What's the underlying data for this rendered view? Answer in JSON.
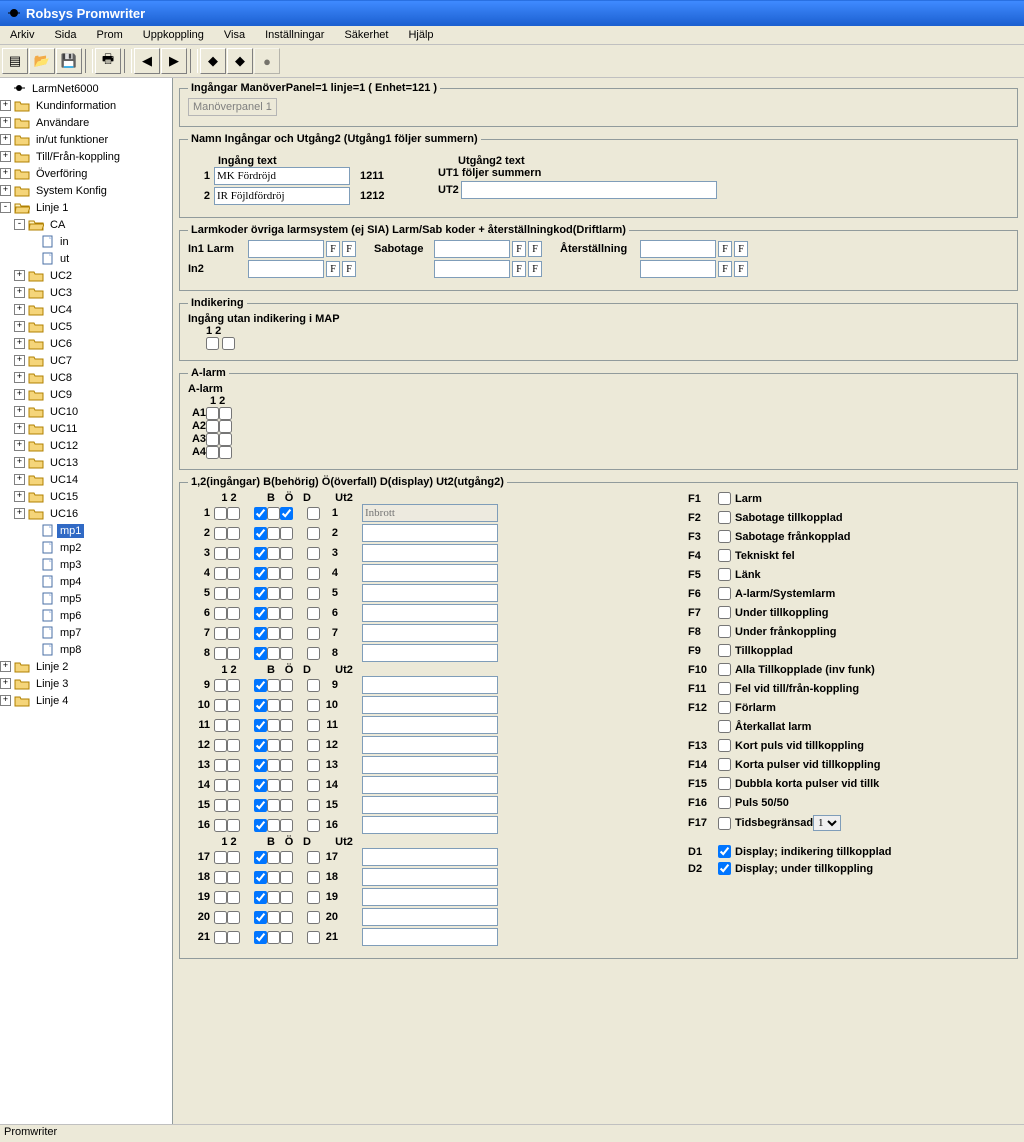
{
  "title": "Robsys Promwriter",
  "menu": [
    "Arkiv",
    "Sida",
    "Prom",
    "Uppkoppling",
    "Visa",
    "Inställningar",
    "Säkerhet",
    "Hjälp"
  ],
  "tree": {
    "root": "LarmNet6000",
    "top": [
      "Kundinformation",
      "Användare",
      "in/ut funktioner",
      "Till/Från-koppling",
      "Överföring",
      "System Konfig"
    ],
    "linje1": "Linje 1",
    "ca": "CA",
    "ca_in": "in",
    "ca_ut": "ut",
    "uc": [
      "UC2",
      "UC3",
      "UC4",
      "UC5",
      "UC6",
      "UC7",
      "UC8",
      "UC9",
      "UC10",
      "UC11",
      "UC12",
      "UC13",
      "UC14",
      "UC15",
      "UC16"
    ],
    "mp": [
      "mp1",
      "mp2",
      "mp3",
      "mp4",
      "mp5",
      "mp6",
      "mp7",
      "mp8"
    ],
    "linjer": [
      "Linje 2",
      "Linje 3",
      "Linje 4"
    ]
  },
  "fs1": {
    "legend": "Ingångar ManöverPanel=1 linje=1   ( Enhet=121 )",
    "panel": "Manöverpanel 1"
  },
  "fs2": {
    "legend": "Namn Ingångar och Utgång2 (Utgång1 följer summern)",
    "h_in": "Ingång text",
    "h_ut": "Utgång2 text",
    "r1_n": "1",
    "r1_in": "MK Fördröjd",
    "r1_code": "1211",
    "r1_utlabel": "UT1 följer summern",
    "r2_n": "2",
    "r2_in": "IR Föjldfördröj",
    "r2_code": "1212",
    "r2_utlabel": "UT2",
    "r2_ut": ""
  },
  "fs3": {
    "legend": "Larmkoder övriga larmsystem (ej SIA)   Larm/Sab koder + återställningkod(Driftlarm)",
    "in1": "In1 Larm",
    "in2": "In2",
    "sab": "Sabotage",
    "rst": "Återställning",
    "F": "F"
  },
  "fs4": {
    "legend": "Indikering",
    "txt": "Ingång utan indikering i MAP",
    "h12": "1 2"
  },
  "fs5": {
    "legend": "A-larm",
    "txt": "A-larm",
    "h12": "1 2",
    "rows": [
      "A1",
      "A2",
      "A3",
      "A4"
    ]
  },
  "fs6": {
    "legend": "1,2(ingångar)  B(behörig) Ö(överfall) D(display) Ut2(utgång2)",
    "h12": "1  2",
    "hB": "B",
    "hO": "Ö",
    "hD": "D",
    "hUt": "Ut2",
    "placeholder": "Inbrott",
    "f": [
      {
        "id": "F1",
        "label": "Larm"
      },
      {
        "id": "F2",
        "label": "Sabotage tillkopplad"
      },
      {
        "id": "F3",
        "label": "Sabotage frånkopplad"
      },
      {
        "id": "F4",
        "label": "Tekniskt fel"
      },
      {
        "id": "F5",
        "label": "Länk"
      },
      {
        "id": "F6",
        "label": "A-larm/Systemlarm"
      },
      {
        "id": "F7",
        "label": "Under tillkoppling"
      },
      {
        "id": "F8",
        "label": "Under frånkoppling"
      },
      {
        "id": "F9",
        "label": "Tillkopplad"
      },
      {
        "id": "F10",
        "label": "Alla Tillkopplade (inv funk)"
      },
      {
        "id": "F11",
        "label": "Fel vid till/från-koppling"
      },
      {
        "id": "F12",
        "label": "Förlarm"
      },
      {
        "id": "",
        "label": "Återkallat larm"
      },
      {
        "id": "F13",
        "label": "Kort puls vid tillkoppling"
      },
      {
        "id": "F14",
        "label": "Korta pulser vid tillkoppling"
      },
      {
        "id": "F15",
        "label": "Dubbla korta pulser vid tillk"
      },
      {
        "id": "F16",
        "label": "Puls 50/50"
      },
      {
        "id": "F17",
        "label": "Tidsbegränsad",
        "select": "1"
      }
    ],
    "d": [
      {
        "id": "D1",
        "label": "Display; indikering tillkopplad",
        "checked": true
      },
      {
        "id": "D2",
        "label": "Display; under tillkoppling",
        "checked": true
      }
    ]
  },
  "status": "Promwriter"
}
